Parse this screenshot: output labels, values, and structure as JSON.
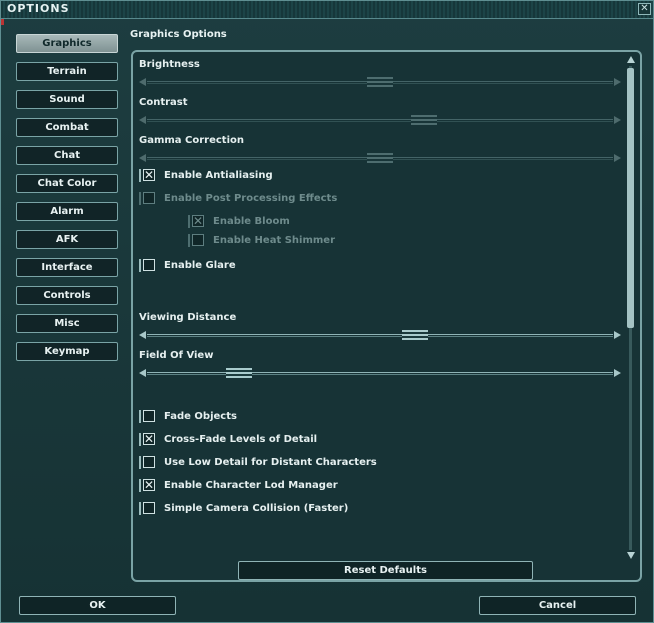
{
  "window": {
    "title": "OPTIONS",
    "close_label": "✕"
  },
  "sidebar": {
    "items": [
      {
        "label": "Graphics",
        "active": true
      },
      {
        "label": "Terrain"
      },
      {
        "label": "Sound"
      },
      {
        "label": "Combat"
      },
      {
        "label": "Chat"
      },
      {
        "label": "Chat Color"
      },
      {
        "label": "Alarm"
      },
      {
        "label": "AFK"
      },
      {
        "label": "Interface"
      },
      {
        "label": "Controls"
      },
      {
        "label": "Misc"
      },
      {
        "label": "Keymap"
      }
    ]
  },
  "graphics": {
    "section_title": "Graphics Options",
    "brightness": {
      "label": "Brightness",
      "value_fraction": 0.5,
      "enabled": false
    },
    "contrast": {
      "label": "Contrast",
      "value_fraction": 0.6,
      "enabled": false
    },
    "gamma": {
      "label": "Gamma Correction",
      "value_fraction": 0.5,
      "enabled": false
    },
    "antialiasing": {
      "label": "Enable Antialiasing",
      "checked": true
    },
    "post_processing": {
      "label": "Enable Post Processing Effects",
      "checked": false,
      "enabled": false
    },
    "bloom": {
      "label": "Enable Bloom",
      "checked": true,
      "enabled": false
    },
    "heat_shimmer": {
      "label": "Enable Heat Shimmer",
      "checked": false,
      "enabled": false
    },
    "glare": {
      "label": "Enable Glare",
      "checked": false
    },
    "viewing_distance": {
      "label": "Viewing Distance",
      "value_fraction": 0.58
    },
    "field_of_view": {
      "label": "Field Of View",
      "value_fraction": 0.18
    },
    "fade_objects": {
      "label": "Fade Objects",
      "checked": false
    },
    "crossfade_lod": {
      "label": "Cross-Fade Levels of Detail",
      "checked": true
    },
    "low_detail_chars": {
      "label": "Use Low Detail for Distant Characters",
      "checked": false
    },
    "char_lod_manager": {
      "label": "Enable Character Lod Manager",
      "checked": true
    },
    "camera_collision": {
      "label": "Simple Camera Collision (Faster)",
      "checked": false
    }
  },
  "buttons": {
    "reset": "Reset Defaults",
    "ok": "OK",
    "cancel": "Cancel"
  },
  "check_glyph": "✕",
  "colors": {
    "accent": "#7aa3a5",
    "background": "#173336",
    "active_tab": "#a8b9b9"
  }
}
